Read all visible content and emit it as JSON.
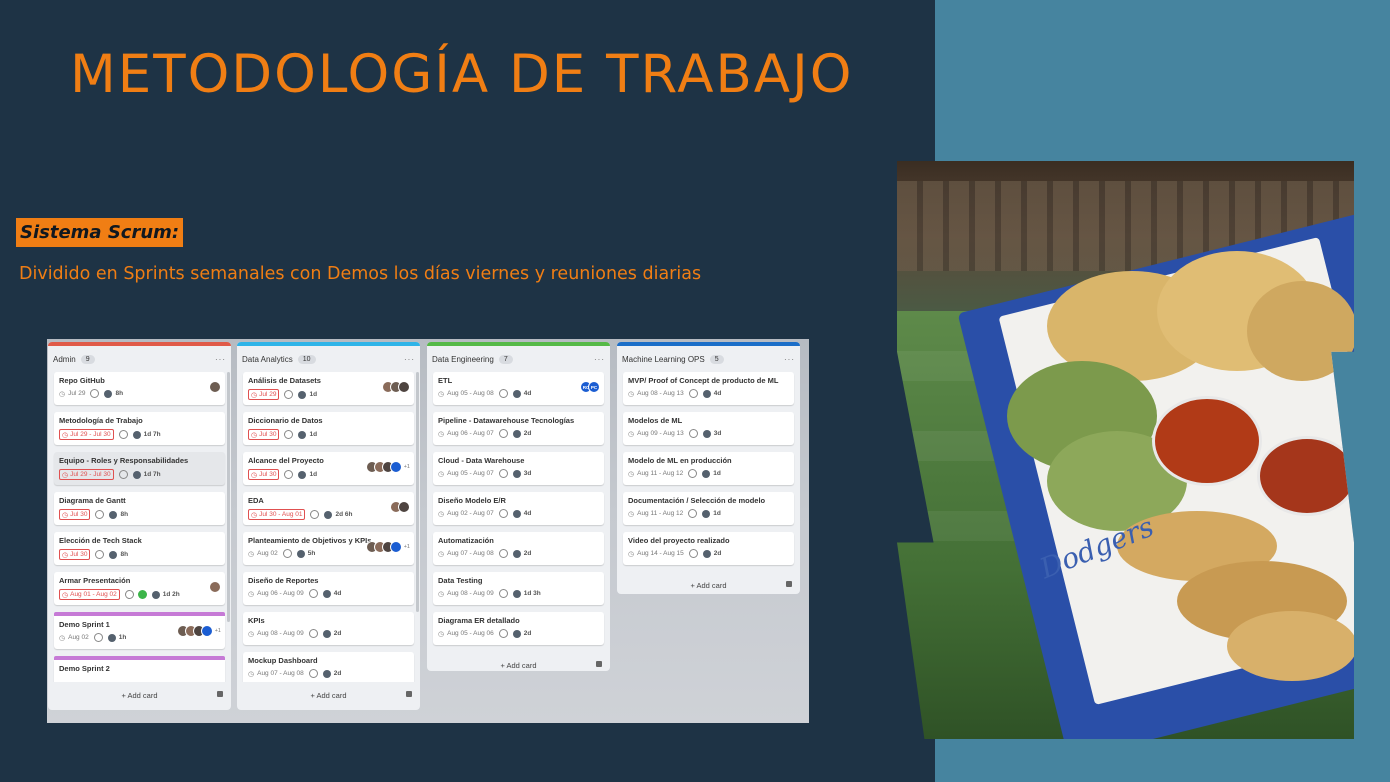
{
  "slide": {
    "title": "METODOLOGÍA DE TRABAJO",
    "subtitle": "Sistema Scrum:",
    "description": "Dividido en Sprints semanales con Demos los días viernes y reuniones diarias"
  },
  "photo": {
    "logo_text": "Dodgers"
  },
  "board": {
    "add_card_label": "+ Add card",
    "more_label": "···",
    "columns": [
      {
        "name": "Admin",
        "count": "9",
        "color": "#e05a48",
        "cards": [
          {
            "title": "Repo GitHub",
            "date": "Jul 29",
            "duration": "8h"
          },
          {
            "title": "Metodología de Trabajo",
            "date": "Jul 29 - Jul 30",
            "duration": "1d 7h"
          },
          {
            "title": "Equipo - Roles y Responsabilidades",
            "date": "Jul 29 - Jul 30",
            "duration": "1d 7h"
          },
          {
            "title": "Diagrama de Gantt",
            "date": "Jul 30",
            "duration": "8h"
          },
          {
            "title": "Elección de Tech Stack",
            "date": "Jul 30",
            "duration": "8h"
          },
          {
            "title": "Armar Presentación",
            "date": "Aug 01 - Aug 02",
            "duration": "1d 2h"
          },
          {
            "title": "Demo Sprint 1",
            "date": "Aug 02",
            "duration": "1h",
            "more": "+1"
          },
          {
            "title": "Demo Sprint 2"
          }
        ]
      },
      {
        "name": "Data Analytics",
        "count": "10",
        "color": "#2fb4e8",
        "cards": [
          {
            "title": "Análisis de Datasets",
            "date": "Jul 29",
            "duration": "1d"
          },
          {
            "title": "Diccionario de Datos",
            "date": "Jul 30",
            "duration": "1d"
          },
          {
            "title": "Alcance del Proyecto",
            "date": "Jul 30",
            "duration": "1d",
            "more": "+1"
          },
          {
            "title": "EDA",
            "date": "Jul 30 - Aug 01",
            "duration": "2d 6h"
          },
          {
            "title": "Planteamiento de Objetivos y KPIs",
            "date": "Aug 02",
            "duration": "5h",
            "more": "+1"
          },
          {
            "title": "Diseño de Reportes",
            "date": "Aug 06 - Aug 09",
            "duration": "4d"
          },
          {
            "title": "KPIs",
            "date": "Aug 08 - Aug 09",
            "duration": "2d"
          },
          {
            "title": "Mockup Dashboard",
            "date": "Aug 07 - Aug 08",
            "duration": "2d"
          }
        ]
      },
      {
        "name": "Data Engineering",
        "count": "7",
        "color": "#55b947",
        "cards": [
          {
            "title": "ETL",
            "date": "Aug 05 - Aug 08",
            "duration": "4d",
            "initials": [
              "RC",
              "PC"
            ]
          },
          {
            "title": "Pipeline - Datawarehouse Tecnologías",
            "date": "Aug 06 - Aug 07",
            "duration": "2d"
          },
          {
            "title": "Cloud - Data Warehouse",
            "date": "Aug 05 - Aug 07",
            "duration": "3d"
          },
          {
            "title": "Diseño Modelo E/R",
            "date": "Aug 02 - Aug 07",
            "duration": "4d"
          },
          {
            "title": "Automatización",
            "date": "Aug 07 - Aug 08",
            "duration": "2d"
          },
          {
            "title": "Data Testing",
            "date": "Aug 08 - Aug 09",
            "duration": "1d 3h"
          },
          {
            "title": "Diagrama ER detallado",
            "date": "Aug 05 - Aug 06",
            "duration": "2d"
          }
        ]
      },
      {
        "name": "Machine Learning OPS",
        "count": "5",
        "color": "#1b6ec8",
        "cards": [
          {
            "title": "MVP/ Proof of Concept de producto de ML",
            "date": "Aug 08 - Aug 13",
            "duration": "4d"
          },
          {
            "title": "Modelos de ML",
            "date": "Aug 09 - Aug 13",
            "duration": "3d"
          },
          {
            "title": "Modelo de ML en producción",
            "date": "Aug 11 - Aug 12",
            "duration": "1d"
          },
          {
            "title": "Documentación / Selección de modelo",
            "date": "Aug 11 - Aug 12",
            "duration": "1d"
          },
          {
            "title": "Video del proyecto realizado",
            "date": "Aug 14 - Aug 15",
            "duration": "2d"
          }
        ]
      }
    ]
  }
}
